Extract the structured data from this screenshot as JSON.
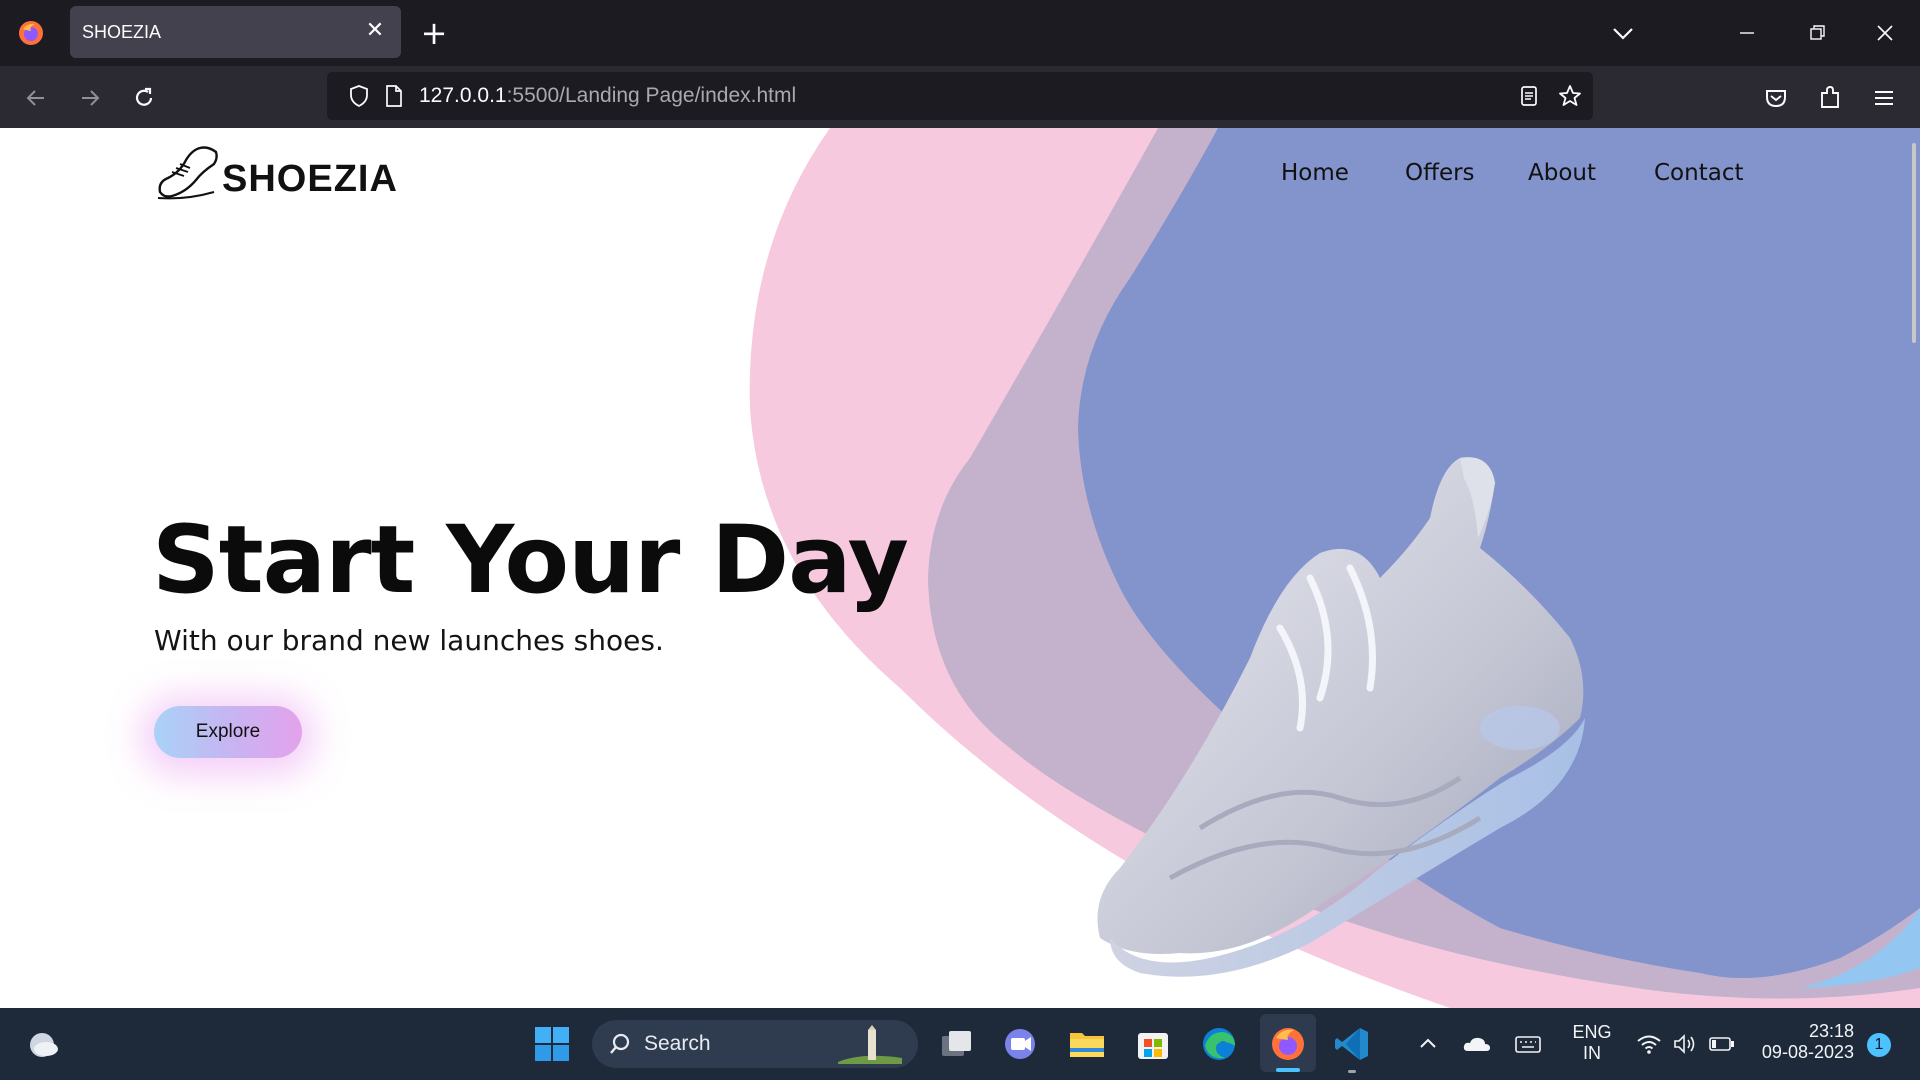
{
  "browser": {
    "tab_title": "SHOEZIA",
    "tab_close": "✕",
    "new_tab": "+",
    "url_host": "127.0.0.1",
    "url_rest": ":5500/Landing Page/index.html"
  },
  "site": {
    "logo_text": "SHOEZIA",
    "nav": [
      "Home",
      "Offers",
      "About",
      "Contact"
    ],
    "hero_title": "Start Your Day",
    "hero_subtitle": "With our brand new launches shoes.",
    "cta_label": "Explore"
  },
  "taskbar": {
    "search_label": "Search",
    "lang_line1": "ENG",
    "lang_line2": "IN",
    "time": "23:18",
    "date": "09-08-2023",
    "notification_count": "1"
  },
  "colors": {
    "pink_blob": "#f7c9df",
    "mauve_blob": "#c4b2cc",
    "blue_blob": "#8393cc",
    "browser_bg": "#1c1b22",
    "toolbar_bg": "#2b2a33",
    "taskbar_bg": "#1e2a3a"
  },
  "icons": [
    "firefox-icon",
    "close-icon",
    "plus-icon",
    "chevron-down-icon",
    "minimize-icon",
    "restore-icon",
    "window-close-icon",
    "back-icon",
    "forward-icon",
    "reload-icon",
    "shield-icon",
    "page-icon",
    "reader-view-icon",
    "star-icon",
    "pocket-icon",
    "extensions-icon",
    "menu-icon",
    "weather-icon",
    "windows-start-icon",
    "search-icon",
    "task-view-icon",
    "teams-icon",
    "file-explorer-icon",
    "store-icon",
    "edge-icon",
    "vscode-icon",
    "tray-chevron-icon",
    "onedrive-icon",
    "keyboard-icon",
    "wifi-icon",
    "volume-icon",
    "battery-icon"
  ]
}
